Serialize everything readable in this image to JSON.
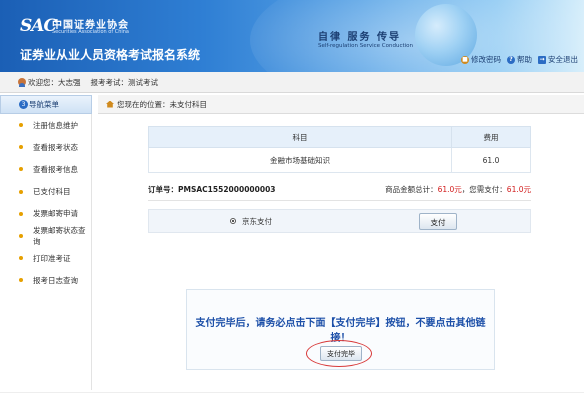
{
  "header": {
    "logo_mark": "SAC",
    "logo_cn": "中国证券业协会",
    "logo_en": "Securities Association of China",
    "system_title": "证券业从业人员资格考试报名系统",
    "slogan_cn": "自律  服务  传导",
    "slogan_en": "Self-regulation  Service  Conduction",
    "links": [
      {
        "label": "修改密码",
        "icon": "lock-icon",
        "color": "#d08a1e"
      },
      {
        "label": "帮助",
        "icon": "help-icon",
        "color": "#2b6cc4"
      },
      {
        "label": "安全退出",
        "icon": "logout-icon",
        "color": "#2b6cc4"
      }
    ]
  },
  "info_bar": {
    "welcome": "欢迎您：大志强",
    "exam": "报考考试：测试考试"
  },
  "sidebar": {
    "heading_num": "3",
    "heading": "导航菜单",
    "items": [
      {
        "label": "注册信息维护"
      },
      {
        "label": "查看报考状态"
      },
      {
        "label": "查看报考信息"
      },
      {
        "label": "已支付科目"
      },
      {
        "label": "发票邮寄申请"
      },
      {
        "label": "发票邮寄状态查询"
      },
      {
        "label": "打印准考证"
      },
      {
        "label": "报考日志查询"
      }
    ]
  },
  "breadcrumb": "您现在的位置：未支付科目",
  "table": {
    "headers": [
      "科目",
      "费用"
    ],
    "rows": [
      [
        "金融市场基础知识",
        "61.0"
      ]
    ]
  },
  "order": {
    "label": "订单号：PMSAC1552000000003",
    "total_prefix": "商品金额总计：",
    "total_value": "61.0元",
    "sep": "，您需支付：",
    "pay_value": "61.0元"
  },
  "payment": {
    "method": "京东支付",
    "pay_button": "支付"
  },
  "notice": {
    "message": "支付完毕后，请务必点击下面【支付完毕】按钮，不要点击其他链接！",
    "done_button": "支付完毕"
  }
}
